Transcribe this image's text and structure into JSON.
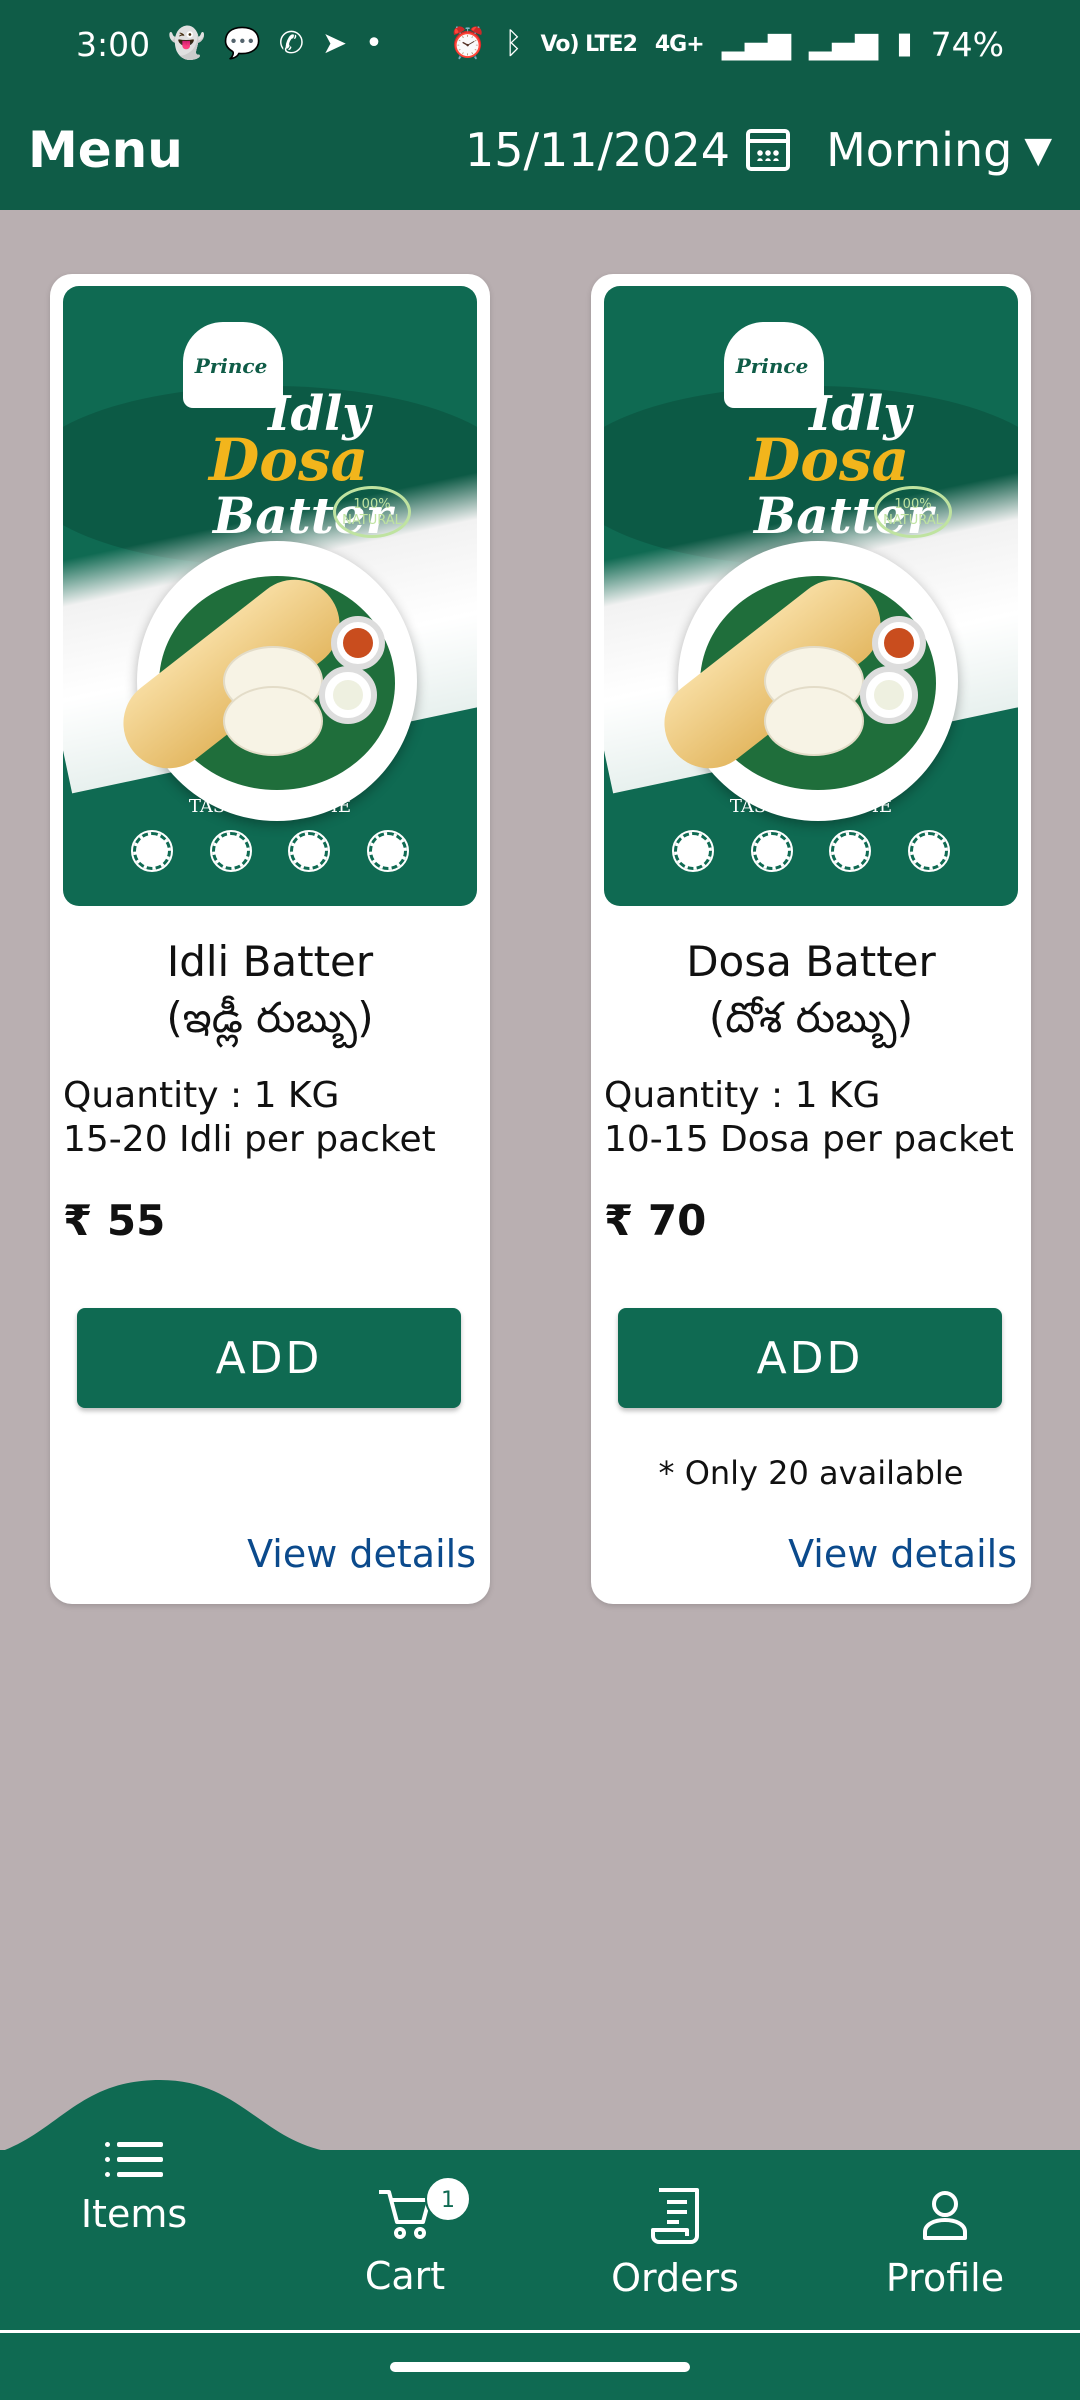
{
  "status": {
    "time": "3:00",
    "network": "4G+",
    "volte": "Vo) LTE2",
    "battery": "74%"
  },
  "header": {
    "title": "Menu",
    "date": "15/11/2024",
    "shift": "Morning"
  },
  "products": [
    {
      "name_en": "Idli Batter",
      "name_te": "(ఇడ్లీ రుబ్బు)",
      "quantity": "Quantity : 1 KG",
      "pieces": "15-20 Idli per packet",
      "price": "₹ 55",
      "add_label": "ADD",
      "availability": "",
      "details_label": "View details",
      "image": {
        "brand": "Prince",
        "title_1": "Idly",
        "title_2": "Dosa",
        "title_3": "Batter",
        "tag": "100% NATURAL",
        "tagline": "TASTE OF HOME"
      }
    },
    {
      "name_en": "Dosa Batter",
      "name_te": "(దోశ రుబ్బు)",
      "quantity": "Quantity : 1 KG",
      "pieces": "10-15 Dosa per packet",
      "price": "₹ 70",
      "add_label": "ADD",
      "availability": "* Only 20 available",
      "details_label": "View details",
      "image": {
        "brand": "Prince",
        "title_1": "Idly",
        "title_2": "Dosa",
        "title_3": "Batter",
        "tag": "100% NATURAL",
        "tagline": "TASTE OF HOME"
      }
    }
  ],
  "nav": {
    "items_label": "Items",
    "cart_label": "Cart",
    "cart_count": "1",
    "orders_label": "Orders",
    "profile_label": "Profile"
  },
  "colors": {
    "primary": "#0f5c47",
    "button": "#0f6a52",
    "background": "#b9afb1",
    "link": "#0b4a8c"
  }
}
